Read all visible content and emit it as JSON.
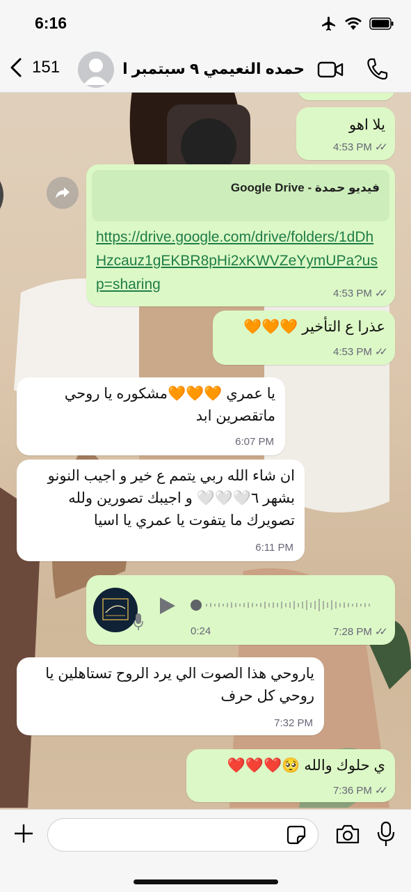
{
  "status_bar": {
    "time": "6:16"
  },
  "header": {
    "back_count": "151",
    "contact_name": "حمده النعيمي ٩ سبتمبر ال...",
    "icons": [
      "chevron-left-icon",
      "avatar",
      "video-icon",
      "phone-icon"
    ]
  },
  "messages": [
    {
      "dir": "out",
      "text": "يلا اهو",
      "time": "4:53 PM",
      "ticks": "✓✓"
    },
    {
      "dir": "out",
      "type": "link",
      "preview_title": "فيديو حمدة - Google Drive",
      "url": "https://drive.google.com/drive/folders/1dDhHzcauz1gEKBR8pHi2xKWVZeYymUPa?usp=sharing",
      "time": "4:53 PM",
      "ticks": "✓✓"
    },
    {
      "dir": "out",
      "text": "عذرا ع التأخير 🧡🧡🧡",
      "time": "4:53 PM",
      "ticks": "✓✓"
    },
    {
      "dir": "in",
      "text": "يا عمري 🧡🧡🧡مشكوره يا روحي ماتقصرين ابد",
      "time": "6:07 PM"
    },
    {
      "dir": "in",
      "text": "ان شاء الله ربي يتمم ع خير و اجيب النونو بشهر ٦🤍🤍🤍 و اجيبك تصورين ولله تصويرك ما يتفوت يا عمري يا اسيا",
      "time": "6:11 PM"
    },
    {
      "dir": "out",
      "type": "voice",
      "duration": "0:24",
      "time": "7:28 PM",
      "ticks": "✓✓",
      "logo_text": "Asia Albaloushi Photography"
    },
    {
      "dir": "in",
      "text": "ياروحي هذا الصوت الي يرد الروح تستاهلين يا روحي كل حرف",
      "time": "7:32 PM"
    },
    {
      "dir": "out",
      "text": "ي حلوك والله 🥺❤️❤️❤️",
      "time": "7:36 PM",
      "ticks": "✓✓"
    }
  ],
  "partial_top_time": "4:53 PM",
  "composer": {
    "placeholder": ""
  },
  "colors": {
    "outgoing": "#dcf8c6",
    "incoming": "#ffffff",
    "link": "#1e7d48"
  }
}
